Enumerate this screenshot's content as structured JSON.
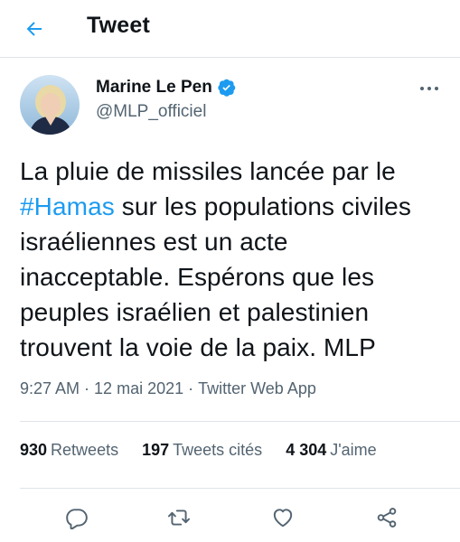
{
  "header": {
    "title": "Tweet",
    "back_icon": "arrow-left-icon"
  },
  "author": {
    "display_name": "Marine Le Pen",
    "handle": "@MLP_officiel",
    "verified": true
  },
  "tweet": {
    "text_before": "La pluie de missiles lancée par le ",
    "hashtag": "#Hamas",
    "text_after": " sur les populations civiles israéliennes est un acte inacceptable. Espérons que les peuples israélien et palestinien trouvent la voie de la paix. MLP",
    "time": "9:27 AM",
    "date": "12 mai 2021",
    "source": "Twitter Web App",
    "separator": "·"
  },
  "stats": {
    "retweets_count": "930",
    "retweets_label": "Retweets",
    "quotes_count": "197",
    "quotes_label": "Tweets cités",
    "likes_count": "4 304",
    "likes_label": "J'aime"
  },
  "colors": {
    "accent": "#1d9bf0",
    "text": "#0f1419",
    "secondary": "#536471",
    "border": "#dfe4e8"
  },
  "actions": [
    "reply-icon",
    "retweet-icon",
    "like-icon",
    "share-icon"
  ]
}
